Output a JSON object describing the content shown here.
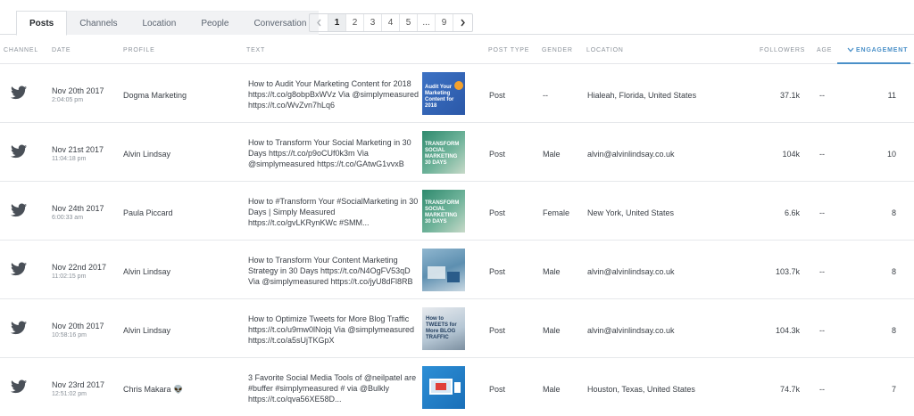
{
  "tabs": [
    "Posts",
    "Channels",
    "Location",
    "People",
    "Conversation"
  ],
  "pagination": {
    "pages": [
      "1",
      "2",
      "3",
      "4",
      "5",
      "...",
      "9"
    ],
    "current": "1",
    "prev_icon": "chevron-left",
    "next_icon": "chevron-right"
  },
  "columns": {
    "channel": "CHANNEL",
    "date": "DATE",
    "profile": "PROFILE",
    "text": "TEXT",
    "post_type": "POST TYPE",
    "gender": "GENDER",
    "location": "LOCATION",
    "followers": "FOLLOWERS",
    "age": "AGE",
    "engagement": "ENGAGEMENT"
  },
  "sort": {
    "column": "engagement",
    "direction": "desc",
    "icon": "chevron-down"
  },
  "colors": {
    "accent": "#4a90c8",
    "twitter_icon": "#4a5058"
  },
  "rows": [
    {
      "channel_icon": "twitter",
      "date": "Nov 20th 2017",
      "time": "2:04:05 pm",
      "profile": "Dogma Marketing",
      "text": "How to Audit Your Marketing Content for 2018 https://t.co/g8obpBxWVz Via @simplymeasured https://t.co/WvZvn7hLq6",
      "thumb_text": "Audit Your Marketing Content for 2018",
      "post_type": "Post",
      "gender": "--",
      "location": "Hialeah, Florida, United States",
      "followers": "37.1k",
      "age": "--",
      "engagement": "11"
    },
    {
      "channel_icon": "twitter",
      "date": "Nov 21st 2017",
      "time": "11:04:18 pm",
      "profile": "Alvin Lindsay",
      "text": "How to Transform Your Social Marketing in 30 Days https://t.co/p9oCUf0k3m Via @simplymeasured https://t.co/GAtwG1vvxB",
      "thumb_text": "TRANSFORM SOCIAL MARKETING 30 DAYS",
      "post_type": "Post",
      "gender": "Male",
      "location": "alvin@alvinlindsay.co.uk",
      "followers": "104k",
      "age": "--",
      "engagement": "10"
    },
    {
      "channel_icon": "twitter",
      "date": "Nov 24th 2017",
      "time": "6:00:33 am",
      "profile": "Paula Piccard",
      "text": "How to #Transform Your #SocialMarketing in 30 Days | Simply Measured https://t.co/gvLKRynKWc #SMM...",
      "thumb_text": "TRANSFORM SOCIAL MARKETING 30 DAYS",
      "post_type": "Post",
      "gender": "Female",
      "location": "New York, United States",
      "followers": "6.6k",
      "age": "--",
      "engagement": "8"
    },
    {
      "channel_icon": "twitter",
      "date": "Nov 22nd 2017",
      "time": "11:02:15 pm",
      "profile": "Alvin Lindsay",
      "text": "How to Transform Your Content Marketing Strategy in 30 Days https://t.co/N4OgFV53qD Via @simplymeasured https://t.co/jyU8dFl8RB",
      "thumb_text": "",
      "post_type": "Post",
      "gender": "Male",
      "location": "alvin@alvinlindsay.co.uk",
      "followers": "103.7k",
      "age": "--",
      "engagement": "8"
    },
    {
      "channel_icon": "twitter",
      "date": "Nov 20th 2017",
      "time": "10:58:16 pm",
      "profile": "Alvin Lindsay",
      "text": "How to Optimize Tweets for More Blog Traffic https://t.co/u9mw0lNojq Via @simplymeasured https://t.co/a5sUjTKGpX",
      "thumb_text": "How to TWEETS for More BLOG TRAFFIC",
      "post_type": "Post",
      "gender": "Male",
      "location": "alvin@alvinlindsay.co.uk",
      "followers": "104.3k",
      "age": "--",
      "engagement": "8"
    },
    {
      "channel_icon": "twitter",
      "date": "Nov 23rd 2017",
      "time": "12:51:02 pm",
      "profile": "Chris Makara 👽",
      "text": "3 Favorite Social Media Tools of @neilpatel are #buffer #simplymeasured # via @Bulkly https://t.co/qva56XE58D...",
      "thumb_text": "",
      "post_type": "Post",
      "gender": "Male",
      "location": "Houston, Texas, United States",
      "followers": "74.7k",
      "age": "--",
      "engagement": "7"
    }
  ]
}
